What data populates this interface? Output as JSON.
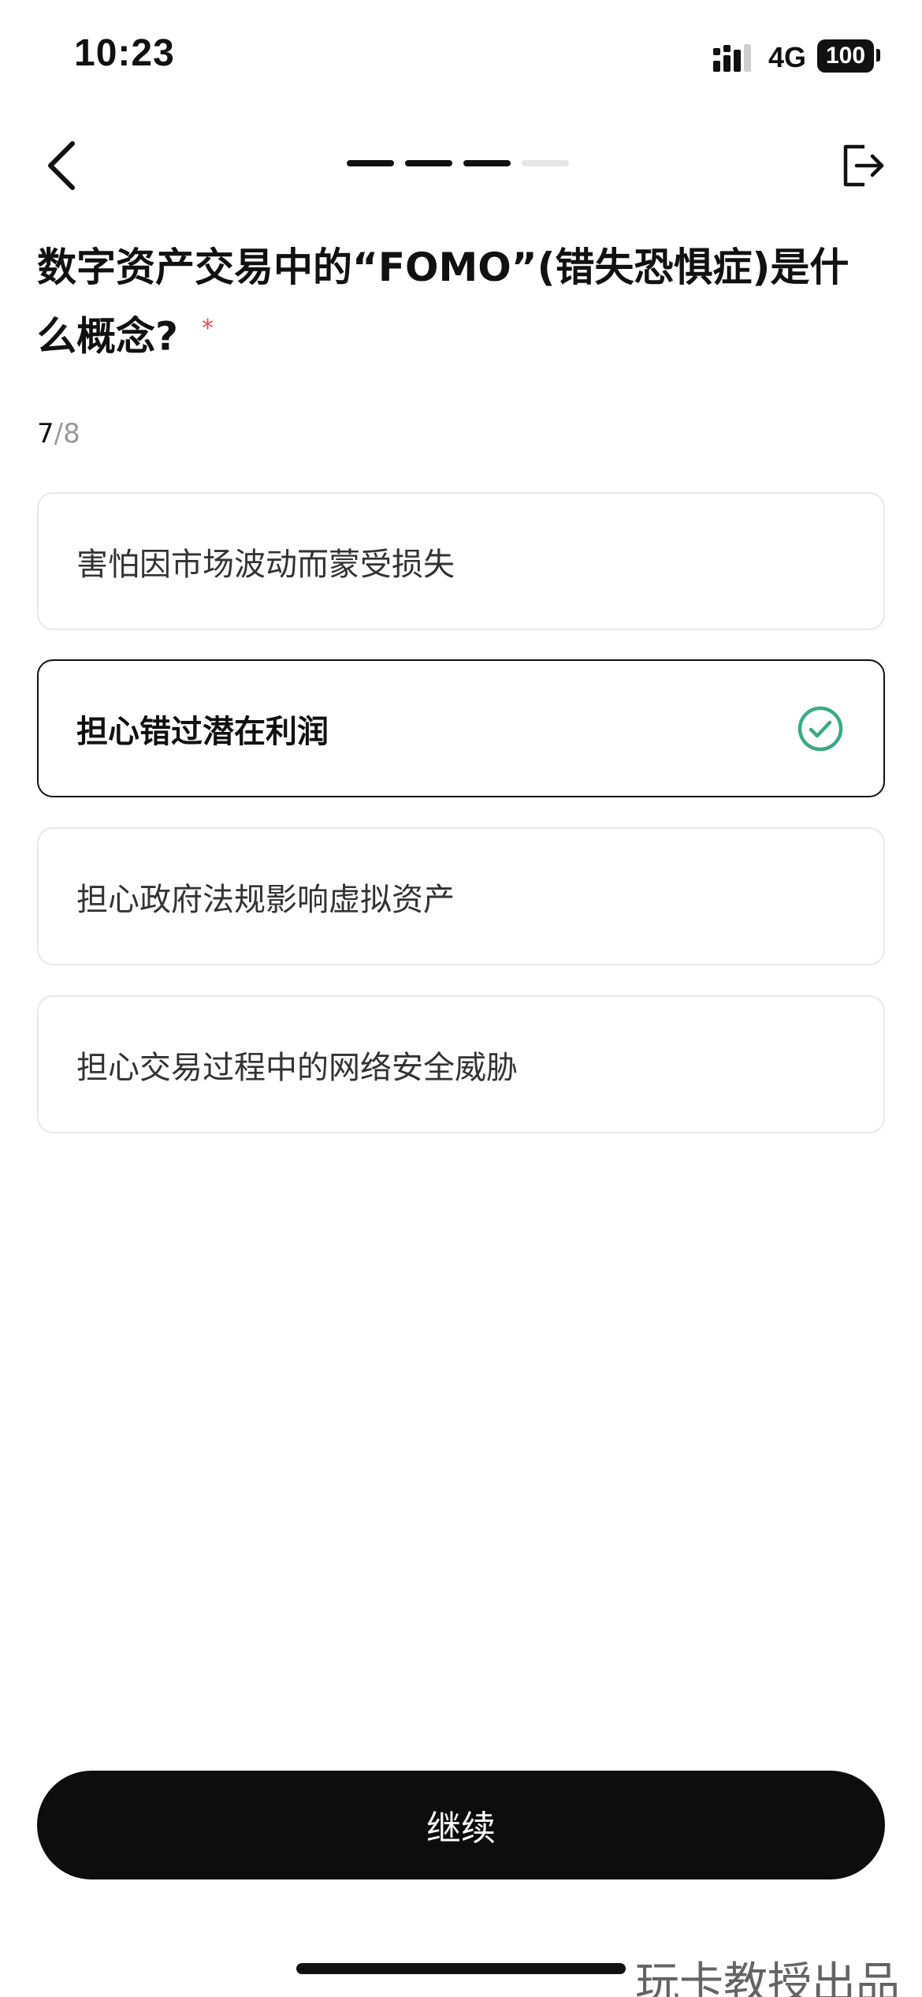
{
  "status_bar": {
    "time": "10:23",
    "network": "4G",
    "battery": "100"
  },
  "nav": {
    "progress_total_segments": 4,
    "progress_completed_segments": 3
  },
  "question": {
    "title": "数字资产交易中的“FOMO”(错失恐惧症)是什么概念?",
    "required_mark": "*",
    "current": "7",
    "total": "/8"
  },
  "options": [
    {
      "label": "害怕因市场波动而蒙受损失",
      "selected": false
    },
    {
      "label": "担心错过潜在利润",
      "selected": true
    },
    {
      "label": "担心政府法规影响虚拟资产",
      "selected": false
    },
    {
      "label": "担心交易过程中的网络安全威胁",
      "selected": false
    }
  ],
  "continue_label": "继续",
  "watermark": "玩卡教授出品",
  "colors": {
    "accent_check": "#3aaa86",
    "required": "#e5484d",
    "button_bg": "#0d0d0d"
  }
}
